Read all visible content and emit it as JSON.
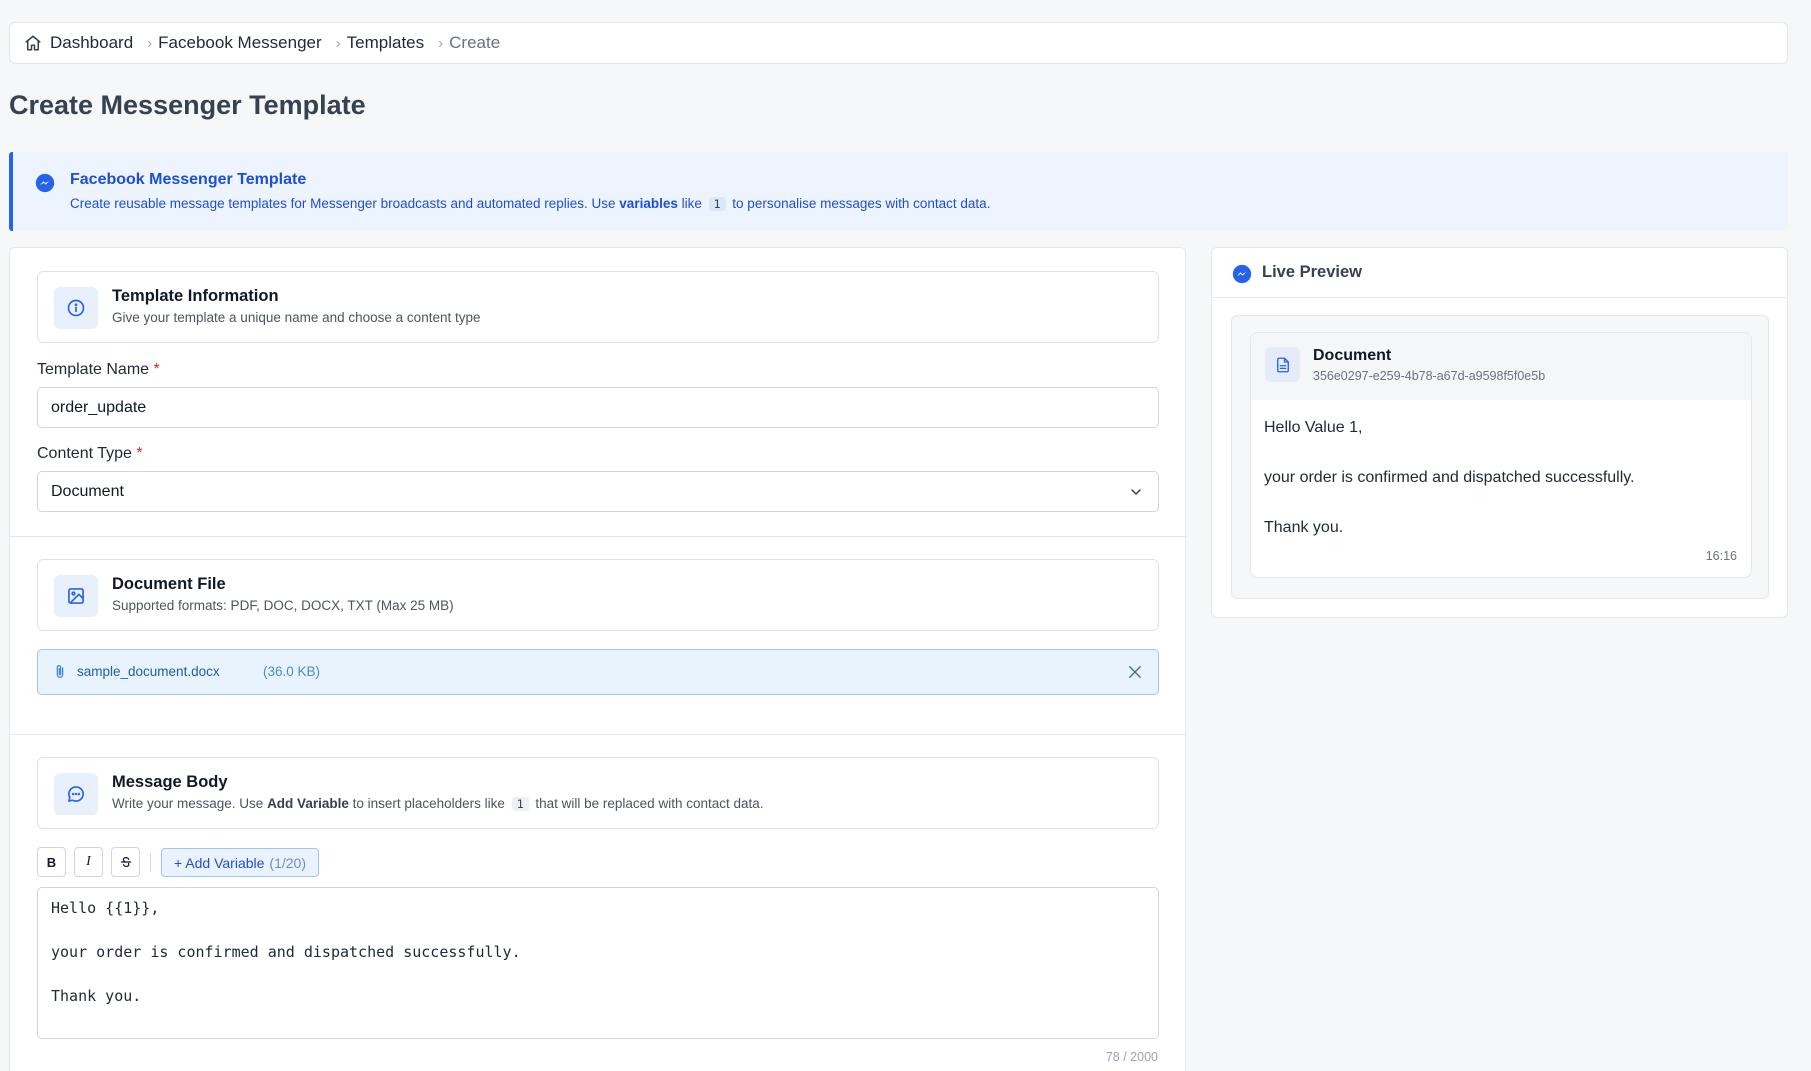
{
  "breadcrumb": {
    "items": [
      "Dashboard",
      "Facebook Messenger",
      "Templates",
      "Create"
    ]
  },
  "page_title": "Create Messenger Template",
  "banner": {
    "title": "Facebook Messenger Template",
    "text_before": "Create reusable message templates for Messenger broadcasts and automated replies. Use ",
    "text_bold": "variables",
    "text_like": " like ",
    "code": "1",
    "text_after": " to personalise messages with contact data."
  },
  "template_info": {
    "title": "Template Information",
    "subtitle": "Give your template a unique name and choose a content type"
  },
  "fields": {
    "name_label": "Template Name",
    "name_value": "order_update",
    "content_type_label": "Content Type",
    "content_type_value": "Document",
    "required_mark": "*"
  },
  "document_file": {
    "title": "Document File",
    "subtitle": "Supported formats: PDF, DOC, DOCX, TXT (Max 25 MB)",
    "file_name": "sample_document.docx",
    "file_size": "(36.0 KB)"
  },
  "message_body": {
    "title": "Message Body",
    "sub_before": "Write your message. Use ",
    "sub_bold": "Add Variable",
    "sub_mid": " to insert placeholders like ",
    "sub_code": "1",
    "sub_after": " that will be replaced with contact data.",
    "toolbar": {
      "bold": "B",
      "italic": "I",
      "add_variable": "+ Add Variable",
      "variable_count": "(1/20)"
    },
    "editor_lines": [
      "Hello {{1}},",
      "your order is confirmed and dispatched successfully.",
      "Thank you."
    ],
    "char_count": "78 / 2000"
  },
  "preview": {
    "title": "Live Preview",
    "doc_title": "Document",
    "doc_id": "356e0297-e259-4b78-a67d-a9598f5f0e5b",
    "lines": [
      "Hello Value 1,",
      "your order is confirmed and dispatched successfully.",
      "Thank you."
    ],
    "time": "16:16"
  },
  "colors": {
    "accent": "#2563eb",
    "required": "#dc2626",
    "banner_bg": "#eef4fd"
  }
}
